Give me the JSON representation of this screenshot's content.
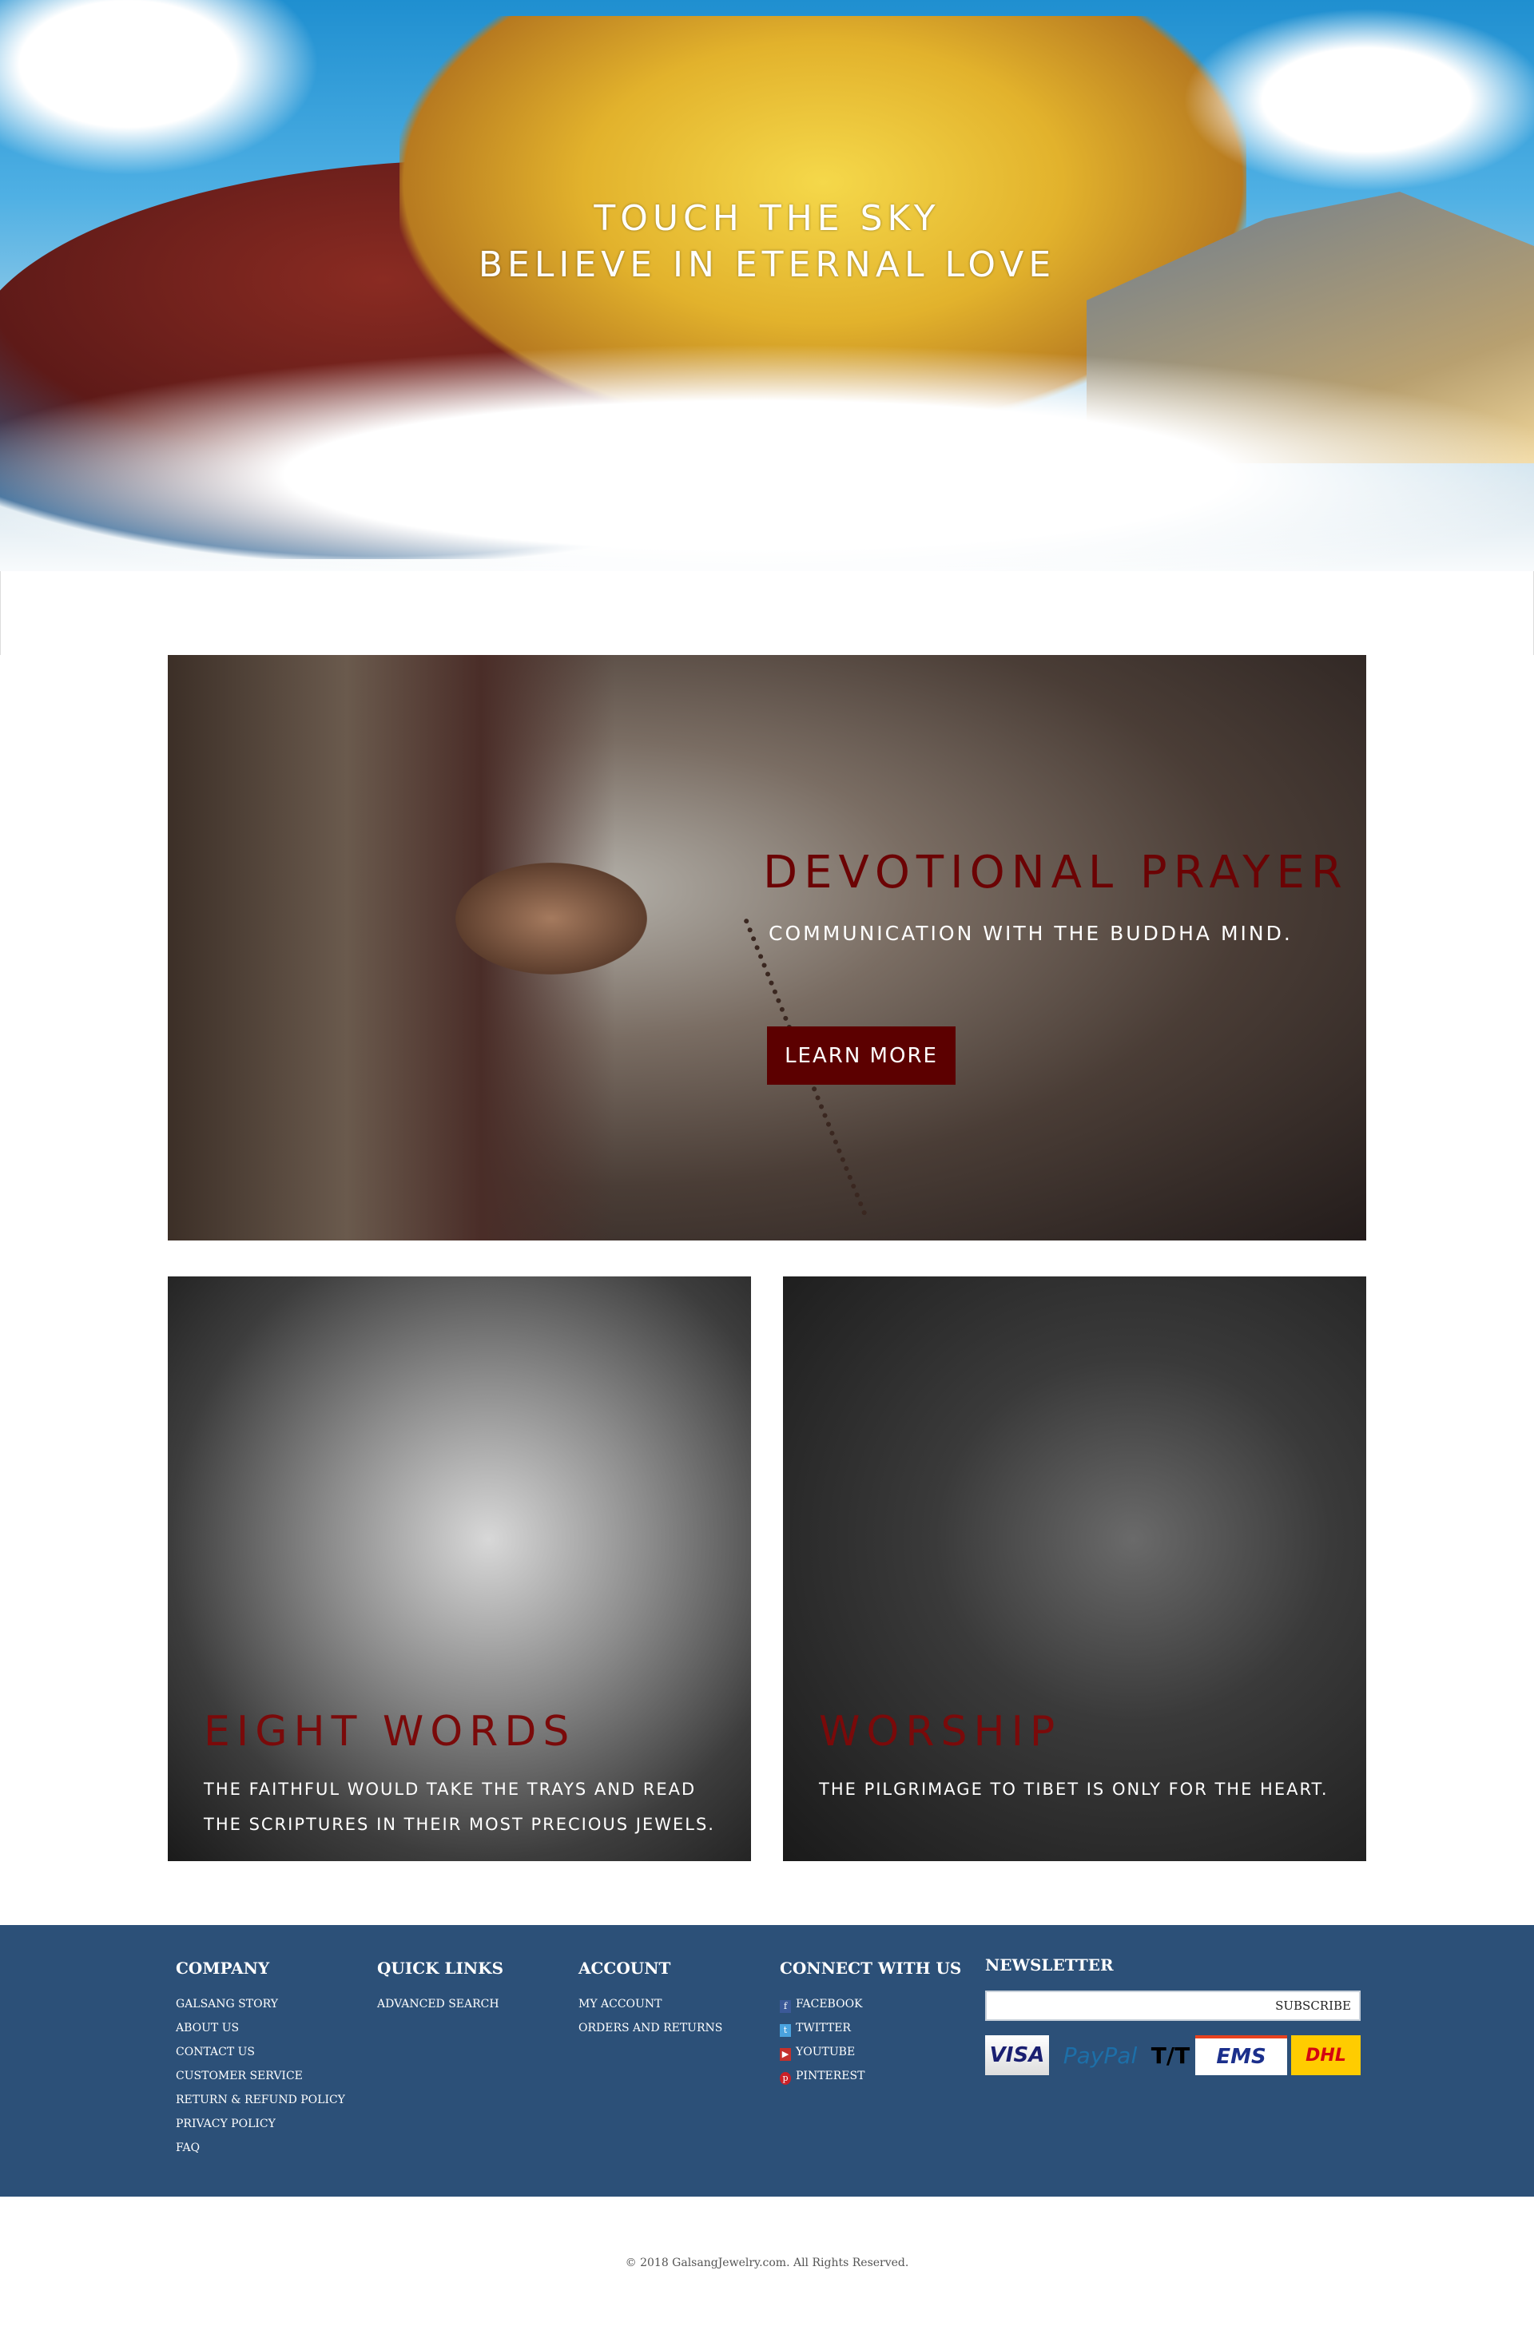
{
  "hero": {
    "line1": "TOUCH THE SKY",
    "line2": "BELIEVE IN ETERNAL LOVE"
  },
  "banner": {
    "title": "DEVOTIONAL PRAYER",
    "subtitle": "COMMUNICATION WITH THE BUDDHA MIND.",
    "button": "LEARN MORE"
  },
  "cards": [
    {
      "title": "EIGHT WORDS",
      "text": "THE FAITHFUL WOULD TAKE THE TRAYS AND READ THE SCRIPTURES IN THEIR MOST PRECIOUS JEWELS."
    },
    {
      "title": "WORSHIP",
      "text": "THE PILGRIMAGE TO TIBET IS ONLY FOR THE HEART."
    }
  ],
  "footer": {
    "company": {
      "heading": "COMPANY",
      "links": [
        "GALSANG STORY",
        "ABOUT US",
        "CONTACT US",
        "CUSTOMER SERVICE",
        "RETURN & REFUND POLICY",
        "PRIVACY POLICY",
        "FAQ"
      ]
    },
    "quick_links": {
      "heading": "QUICK LINKS",
      "links": [
        "ADVANCED SEARCH"
      ]
    },
    "account": {
      "heading": "ACCOUNT",
      "links": [
        "MY ACCOUNT",
        "ORDERS AND RETURNS"
      ]
    },
    "connect": {
      "heading": "CONNECT WITH US",
      "links": [
        {
          "label": "FACEBOOK",
          "icon": "facebook-icon"
        },
        {
          "label": "TWITTER",
          "icon": "twitter-icon"
        },
        {
          "label": "YOUTUBE",
          "icon": "youtube-icon"
        },
        {
          "label": "PINTEREST",
          "icon": "pinterest-icon"
        }
      ]
    },
    "newsletter": {
      "heading": "NEWSLETTER",
      "input_value": "",
      "button": "SUBSCRIBE"
    },
    "payments": [
      "VISA",
      "PayPal",
      "T/T",
      "EMS",
      "DHL"
    ]
  },
  "copyright": "© 2018 GalsangJewelry.com. All Rights Reserved.",
  "colors": {
    "footer_bg": "#2c5078",
    "accent_red": "#5c0000",
    "title_red": "#6b0304"
  }
}
